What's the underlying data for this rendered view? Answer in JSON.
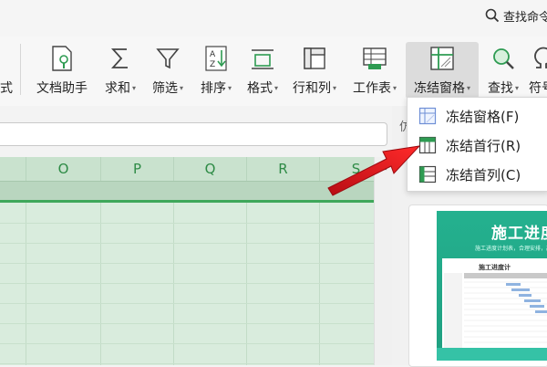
{
  "topbar": {
    "search_label": "查找命令"
  },
  "ribbon": {
    "partial_left_label": "式",
    "buttons": [
      {
        "label": "文档助手",
        "dropdown": false
      },
      {
        "label": "求和",
        "dropdown": true
      },
      {
        "label": "筛选",
        "dropdown": true
      },
      {
        "label": "排序",
        "dropdown": true
      },
      {
        "label": "格式",
        "dropdown": true
      },
      {
        "label": "行和列",
        "dropdown": true
      },
      {
        "label": "工作表",
        "dropdown": true
      },
      {
        "label": "冻结窗格",
        "dropdown": true,
        "active": true
      },
      {
        "label": "查找",
        "dropdown": true
      },
      {
        "label": "符号",
        "dropdown": false
      }
    ],
    "caret": "▾"
  },
  "sheet": {
    "columns": [
      "O",
      "P",
      "Q",
      "R",
      "S"
    ]
  },
  "right_pane": {
    "partial_char": "仿"
  },
  "freeze_menu": {
    "items": [
      {
        "label": "冻结窗格(F)"
      },
      {
        "label": "冻结首行(R)"
      },
      {
        "label": "冻结首列(C)"
      }
    ]
  },
  "template_card": {
    "title": "施工进度",
    "subtitle": "施工进度计划表，合理安排，高效",
    "sheet_title": "施工进度计"
  },
  "colors": {
    "accent_green": "#2e8b46",
    "sheet_bg": "#d9ecdd",
    "arrow_red": "#e0141e",
    "template_green": "#24b18f"
  }
}
